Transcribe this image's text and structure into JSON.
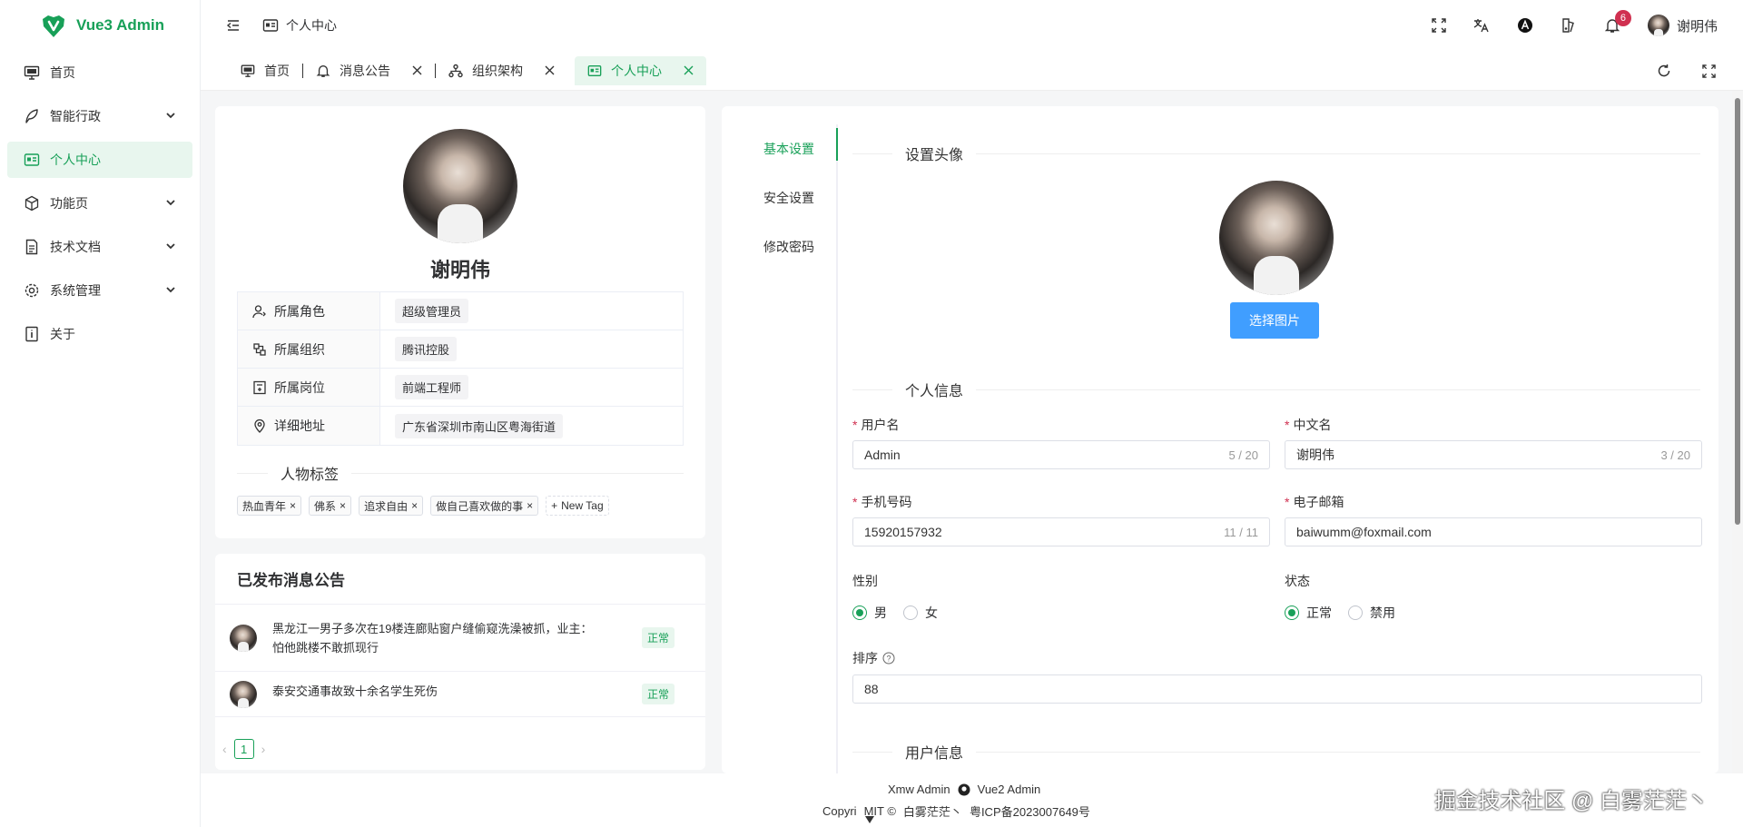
{
  "app": {
    "title": "Vue3 Admin"
  },
  "sidebar": {
    "items": [
      {
        "label": "首页",
        "icon": "monitor-icon",
        "expandable": false,
        "active": false
      },
      {
        "label": "智能行政",
        "icon": "feather-icon",
        "expandable": true,
        "active": false
      },
      {
        "label": "个人中心",
        "icon": "id-card-icon",
        "expandable": false,
        "active": true
      },
      {
        "label": "功能页",
        "icon": "cube-icon",
        "expandable": true,
        "active": false
      },
      {
        "label": "技术文档",
        "icon": "document-icon",
        "expandable": true,
        "active": false
      },
      {
        "label": "系统管理",
        "icon": "gear-icon",
        "expandable": true,
        "active": false
      },
      {
        "label": "关于",
        "icon": "info-icon",
        "expandable": false,
        "active": false
      }
    ]
  },
  "header": {
    "breadcrumb": "个人中心",
    "notification_count": "6",
    "user_name": "谢明伟"
  },
  "tabs": [
    {
      "label": "首页",
      "icon": "monitor-icon",
      "closable": false,
      "active": false
    },
    {
      "label": "消息公告",
      "icon": "bell-icon",
      "closable": true,
      "active": false
    },
    {
      "label": "组织架构",
      "icon": "org-icon",
      "closable": true,
      "active": false
    },
    {
      "label": "个人中心",
      "icon": "id-card-icon",
      "closable": true,
      "active": true
    }
  ],
  "profile": {
    "name": "谢明伟",
    "info": [
      {
        "label": "所属角色",
        "value": "超级管理员",
        "icon": "user-role-icon"
      },
      {
        "label": "所属组织",
        "value": "腾讯控股",
        "icon": "organization-icon"
      },
      {
        "label": "所属岗位",
        "value": "前端工程师",
        "icon": "post-icon"
      },
      {
        "label": "详细地址",
        "value": "广东省深圳市南山区粤海街道",
        "icon": "location-icon"
      }
    ],
    "tags_title": "人物标签",
    "tags": [
      "热血青年",
      "佛系",
      "追求自由",
      "做自己喜欢做的事"
    ],
    "new_tag_label": "New Tag"
  },
  "notices": {
    "title": "已发布消息公告",
    "items": [
      {
        "text": "黑龙江一男子多次在19楼连廊贴窗户缝偷窥洗澡被抓，业主：怕他跳楼不敢抓现行",
        "status": "正常"
      },
      {
        "text": "泰安交通事故致十余名学生死伤",
        "status": "正常"
      }
    ],
    "current_page": "1"
  },
  "settings": {
    "side_tabs": [
      "基本设置",
      "安全设置",
      "修改密码"
    ],
    "avatar_section": "设置头像",
    "choose_button": "选择图片",
    "personal_section": "个人信息",
    "user_section": "用户信息",
    "fields": {
      "username": {
        "label": "用户名",
        "value": "Admin",
        "count": "5 / 20"
      },
      "cn_name": {
        "label": "中文名",
        "value": "谢明伟",
        "count": "3 / 20"
      },
      "phone": {
        "label": "手机号码",
        "value": "15920157932",
        "count": "11 / 11"
      },
      "email": {
        "label": "电子邮箱",
        "value": "baiwumm@foxmail.com"
      },
      "gender": {
        "label": "性别",
        "options": [
          "男",
          "女"
        ],
        "selected": "男"
      },
      "status": {
        "label": "状态",
        "options": [
          "正常",
          "禁用"
        ],
        "selected": "正常"
      },
      "sort": {
        "label": "排序",
        "value": "88"
      }
    }
  },
  "footer": {
    "links": [
      "Xmw Admin",
      "Vue2 Admin"
    ],
    "copyright": "Copyri",
    "license": "MIT ©",
    "author": "白雾茫茫丶",
    "icp": "粤ICP备2023007649号"
  },
  "watermark": "掘金技术社区 @ 白雾茫茫丶",
  "colors": {
    "primary": "#18a058",
    "primary_light": "#e8f6ee",
    "blue_button": "#409eff",
    "badge": "#d03050"
  }
}
